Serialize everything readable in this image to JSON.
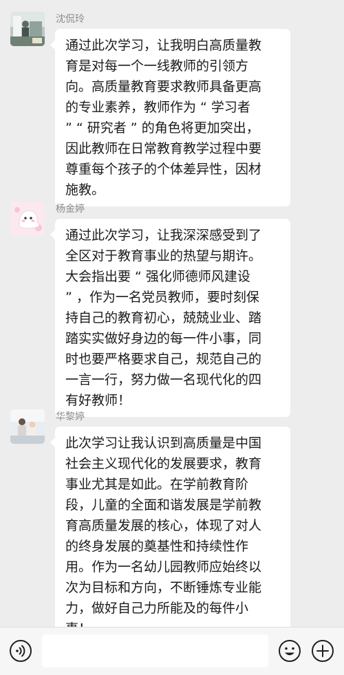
{
  "messages": [
    {
      "sender": "沈侃玲",
      "avatar_icon": "photo-avatar-icon",
      "lines": [
        "通过此次学习，让我明白高质量教",
        "育是对每一个一线教师的引领方",
        "向。高质量教育要求教师具备更高",
        "的专业素养，教师作为 “ 学习者",
        "” “ 研究者 ” 的角色将更加突出，",
        "因此教师在日常教育教学过程中要",
        "尊重每个孩子的个体差异性，因材",
        "施教。"
      ]
    },
    {
      "sender": "杨金婷",
      "avatar_icon": "cartoon-ghost-avatar-icon",
      "lines": [
        "通过此次学习，让我深深感受到了",
        "全区对于教育事业的热望与期许。",
        "大会指出要 “ 强化师德师风建设",
        "” ，作为一名党员教师，要时刻保",
        "持自己的教育初心，兢兢业业、踏",
        "踏实实做好身边的每一件小事，同",
        "时也要严格要求自己，规范自己的",
        "一言一行，努力做一名现代化的四",
        "有好教师！"
      ]
    },
    {
      "sender": "华黎婷",
      "avatar_icon": "family-photo-avatar-icon",
      "lines": [
        "此次学习让我认识到高质量是中国",
        "社会主义现代化的发展要求，教育",
        "事业尤其是如此。在学前教育阶",
        "段，儿童的全面和谐发展是学前教",
        "育高质量发展的核心，体现了对人",
        "的终身发展的奠基性和持续性作",
        "用。作为一名幼儿园教师应始终以",
        "次为目标和方向，不断锤炼专业能",
        "力，做好自己力所能及的每件小",
        "事！"
      ]
    }
  ],
  "input_bar": {
    "voice_icon": "voice-icon",
    "text_value": "",
    "emoji_icon": "emoji-icon",
    "more_icon": "plus-icon"
  },
  "colors": {
    "chat_background": "#ededed",
    "bubble_background": "#ffffff",
    "sender_name": "#8c8c8c",
    "message_text": "#1b1b1b",
    "input_bar_background": "#f6f6f6"
  }
}
